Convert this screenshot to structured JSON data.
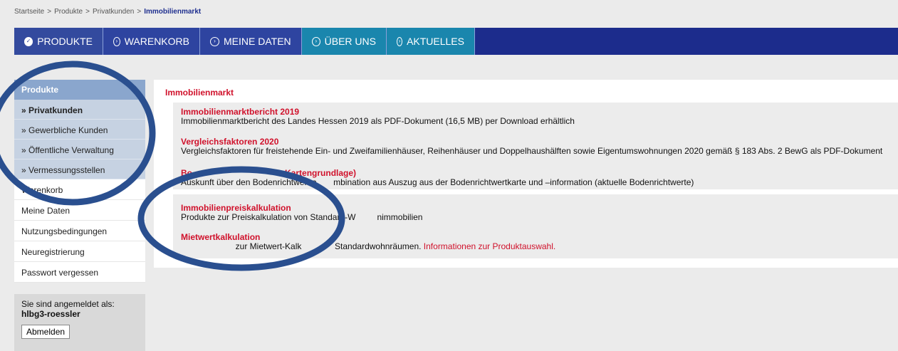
{
  "breadcrumb": {
    "items": [
      "Startseite",
      "Produkte",
      "Privatkunden"
    ],
    "separator": ">",
    "current": "Immobilienmarkt"
  },
  "nav": {
    "tabs": [
      {
        "label": "PRODUKTE",
        "icon": "check-circle-icon",
        "active": true
      },
      {
        "label": "WARENKORB",
        "icon": "chevron-circle-icon"
      },
      {
        "label": "MEINE DATEN",
        "icon": "chevron-circle-icon"
      },
      {
        "label": "ÜBER UNS",
        "icon": "chevron-circle-icon"
      },
      {
        "label": "AKTUELLES",
        "icon": "chevron-circle-icon"
      }
    ]
  },
  "sidebar": {
    "heading": "Produkte",
    "sub_items": [
      "» Privatkunden",
      "» Gewerbliche Kunden",
      "» Öffentliche Verwaltung",
      "» Vermessungsstellen"
    ],
    "items": [
      "Warenkorb",
      "Meine Daten",
      "Nutzungsbedingungen",
      "Neuregistrierung",
      "Passwort vergessen"
    ]
  },
  "login": {
    "label": "Sie sind angemeldet als:",
    "user": "hlbg3-roessler",
    "logout_label": "Abmelden"
  },
  "main": {
    "title": "Immobilienmarkt",
    "entries": [
      {
        "title": "Immobilienmarktbericht 2019",
        "desc": "Immobilienmarktbericht des Landes Hessen 2019 als PDF-Dokument (16,5 MB) per Download erhältlich"
      },
      {
        "title": "Vergleichsfaktoren 2020",
        "desc": "Vergleichsfaktoren für freistehende Ein- und Zweifamilienhäuser, Reihenhäuser und Doppelhaushälften sowie Eigentumswohnungen 2020 gemäß § 183 Abs. 2 BewG als PDF-Dokument"
      },
      {
        "title": "Bo                                       Kartengrundlage)",
        "desc": "Auskunft über den Bodenrichtwert a       mbination aus Auszug aus der Bodenrichtwertkarte und –information (aktuelle Bodenrichtwerte)"
      },
      {
        "title": "Immobilienpreiskalkulation",
        "desc": "Produkte zur Preiskalkulation von Standard-W         nimmobilien"
      },
      {
        "title": "Mietwertkalkulation",
        "desc": "                       zur Mietwert-Kalk              Standardwohnräumen.",
        "link": "Informationen zur Produktauswahl."
      }
    ]
  },
  "colors": {
    "nav_blue": "#1c2c8c",
    "nav_teal": "#1a86ad",
    "accent_red": "#d0112b",
    "annotation_ring": "#2a4f8f"
  }
}
